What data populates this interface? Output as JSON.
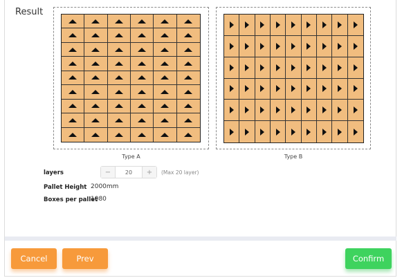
{
  "section": {
    "label": "Result"
  },
  "palletA": {
    "type_label": "Type A",
    "rows": 9,
    "cols": 6,
    "orientation": "up-arrow-icon"
  },
  "palletB": {
    "type_label": "Type B",
    "rows": 6,
    "cols": 9,
    "orientation": "right-arrow-icon"
  },
  "colors": {
    "box_fill": "#f1bd7f",
    "box_border": "#222222",
    "cancel": "#f79a3b",
    "prev": "#f79a3b",
    "confirm": "#3ed35e"
  },
  "fields": {
    "layers_label": "layers",
    "layers_value": "20",
    "layers_hint": "(Max 20 layer)",
    "minus_symbol": "−",
    "plus_symbol": "+",
    "pallet_height_label": "Pallet Height",
    "pallet_height_value": "2000mm",
    "boxes_per_pallet_label": "Boxes per pallet",
    "boxes_per_pallet_value": "1080"
  },
  "footer": {
    "cancel_label": "Cancel",
    "prev_label": "Prev",
    "confirm_label": "Confirm"
  }
}
